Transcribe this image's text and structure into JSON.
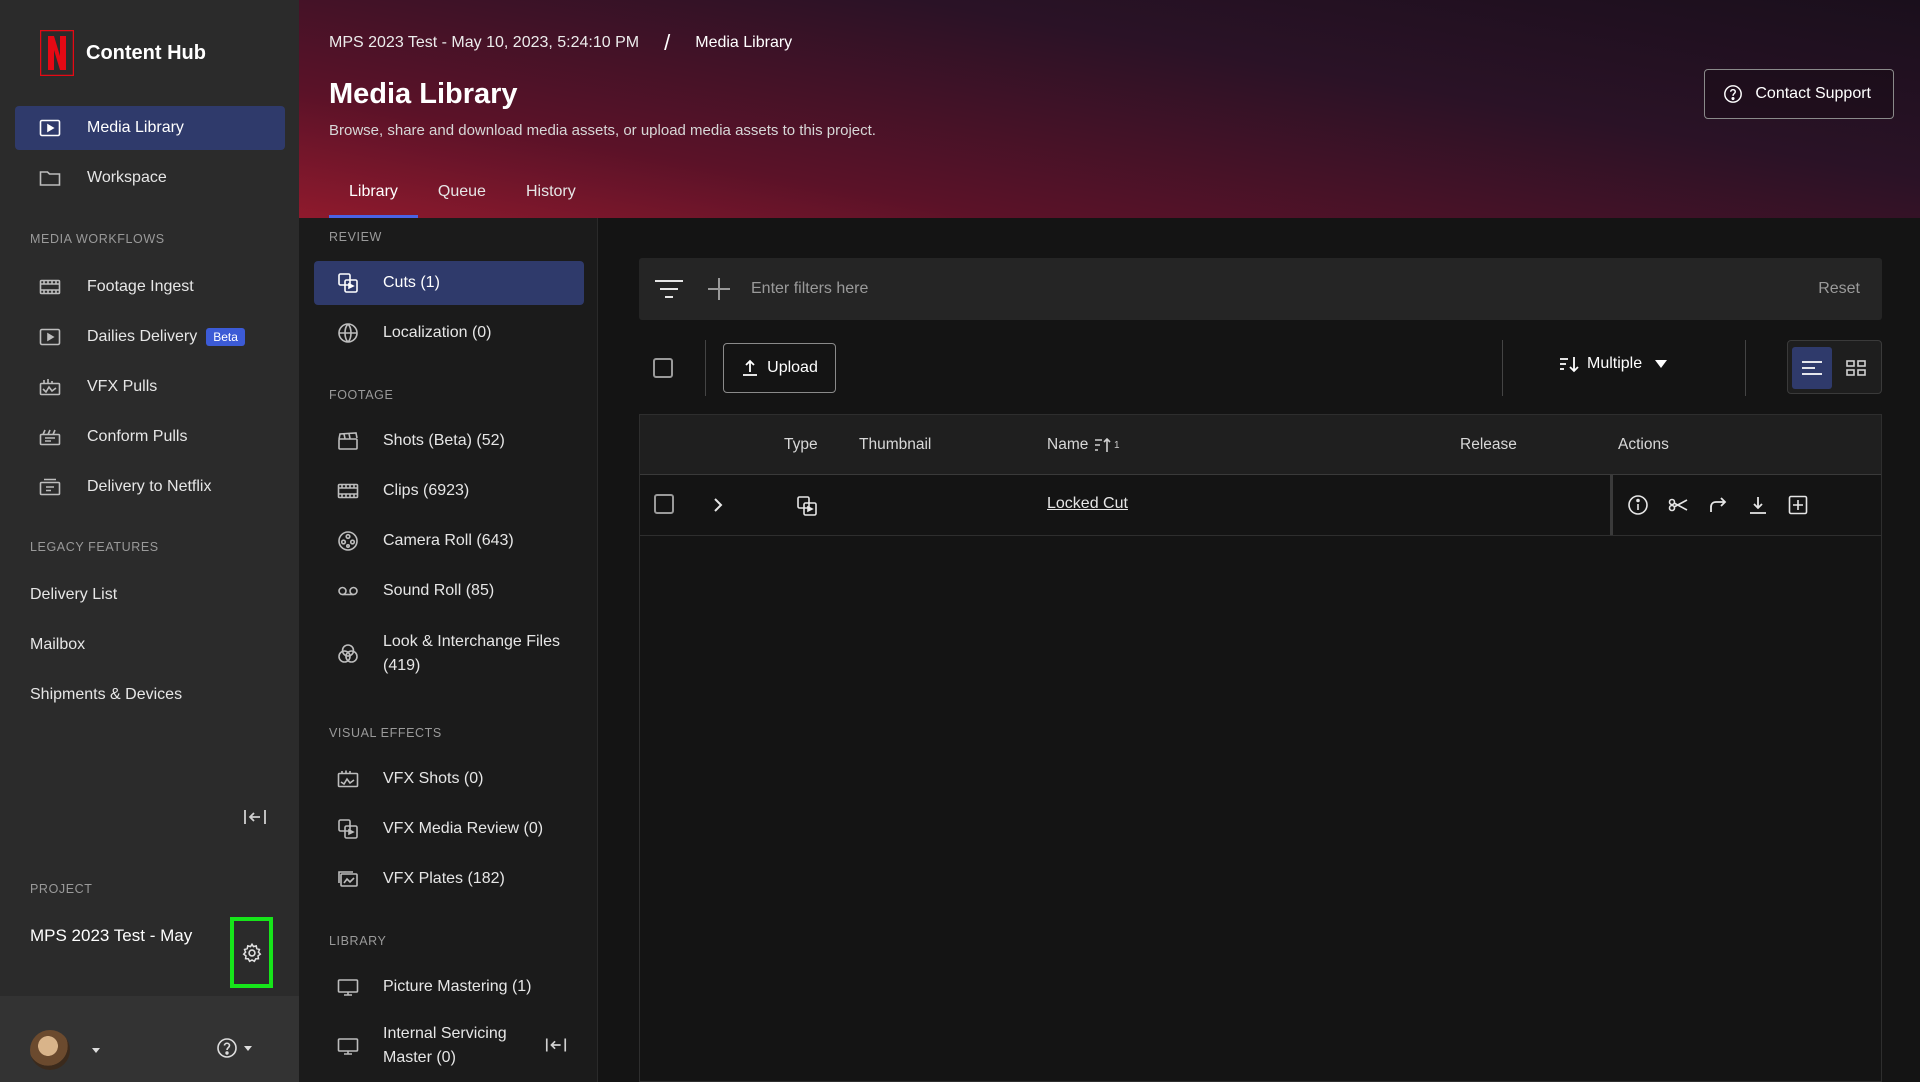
{
  "brand": {
    "name": "Content Hub",
    "logo": "N",
    "logo_color": "#e50914"
  },
  "sidebar": {
    "primary": [
      {
        "label": "Media Library",
        "icon": "play-square-icon",
        "active": true
      },
      {
        "label": "Workspace",
        "icon": "folder-icon",
        "active": false
      }
    ],
    "workflows_label": "MEDIA WORKFLOWS",
    "workflows": [
      {
        "label": "Footage Ingest",
        "icon": "film-strip-icon"
      },
      {
        "label": "Dailies Delivery",
        "icon": "play-square-icon",
        "badge": "Beta"
      },
      {
        "label": "VFX Pulls",
        "icon": "vfx-icon"
      },
      {
        "label": "Conform Pulls",
        "icon": "conform-icon"
      },
      {
        "label": "Delivery to Netflix",
        "icon": "delivery-icon"
      }
    ],
    "legacy_label": "LEGACY FEATURES",
    "legacy": [
      "Delivery List",
      "Mailbox",
      "Shipments & Devices"
    ],
    "project_label": "PROJECT",
    "project_name": "MPS 2023 Test - May"
  },
  "header": {
    "breadcrumb_project": "MPS 2023 Test - May 10, 2023, 5:24:10 PM",
    "breadcrumb_sep": "/",
    "breadcrumb_current": "Media Library",
    "title": "Media Library",
    "subtitle": "Browse, share and download media assets, or upload media assets to this project.",
    "support_label": "Contact Support",
    "tabs": [
      {
        "label": "Library",
        "active": true
      },
      {
        "label": "Queue",
        "active": false
      },
      {
        "label": "History",
        "active": false
      }
    ]
  },
  "subnav": {
    "review_label": "REVIEW",
    "review": [
      {
        "label": "Cuts (1)",
        "active": true
      },
      {
        "label": "Localization (0)"
      }
    ],
    "footage_label": "FOOTAGE",
    "footage": [
      {
        "label": "Shots (Beta) (52)"
      },
      {
        "label": "Clips (6923)"
      },
      {
        "label": "Camera Roll (643)"
      },
      {
        "label": "Sound Roll (85)"
      },
      {
        "label": "Look & Interchange Files (419)"
      }
    ],
    "vfx_label": "VISUAL EFFECTS",
    "vfx": [
      {
        "label": "VFX Shots (0)"
      },
      {
        "label": "VFX Media Review (0)"
      },
      {
        "label": "VFX Plates (182)"
      }
    ],
    "library_label": "LIBRARY",
    "library": [
      {
        "label": "Picture Mastering (1)"
      },
      {
        "label": "Internal Servicing Master (0)"
      }
    ]
  },
  "filters": {
    "placeholder": "Enter filters here",
    "reset_label": "Reset"
  },
  "toolbar": {
    "upload_label": "Upload",
    "sort_label": "Multiple"
  },
  "table": {
    "columns": {
      "type": "Type",
      "thumbnail": "Thumbnail",
      "name": "Name",
      "name_sort_rank": "1",
      "release": "Release",
      "actions": "Actions"
    },
    "rows": [
      {
        "name": "Locked Cut",
        "release": ""
      }
    ]
  },
  "colors": {
    "accent": "#2f3a6b",
    "tab_indicator": "#4a63e6",
    "highlight_box": "#16e51a"
  }
}
